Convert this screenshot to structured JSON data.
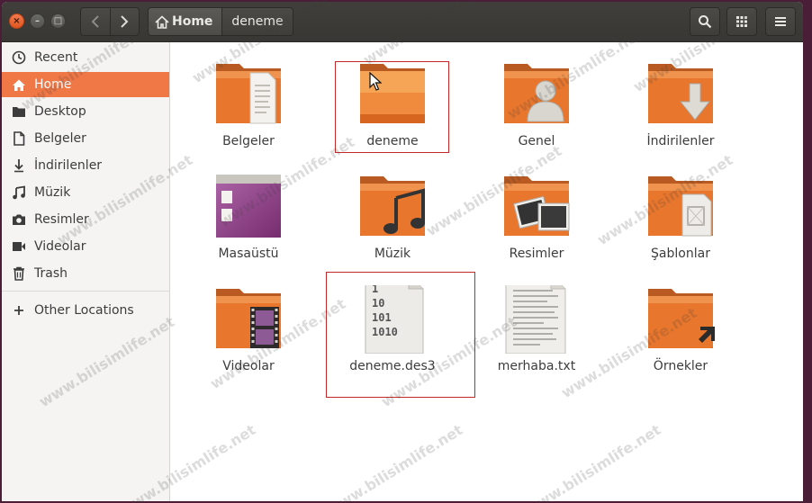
{
  "window": {
    "buttons": {
      "close": "×",
      "minimize": "–",
      "maximize": "□"
    }
  },
  "header": {
    "path": [
      {
        "label": "Home",
        "icon": "home-icon"
      },
      {
        "label": "deneme"
      }
    ],
    "buttons": [
      "search-icon",
      "view-grid-icon",
      "menu-icon"
    ]
  },
  "sidebar": {
    "items": [
      {
        "label": "Recent",
        "icon": "clock-icon"
      },
      {
        "label": "Home",
        "icon": "home-icon",
        "active": true
      },
      {
        "label": "Desktop",
        "icon": "desktop-folder-icon"
      },
      {
        "label": "Belgeler",
        "icon": "document-icon"
      },
      {
        "label": "İndirilenler",
        "icon": "download-icon"
      },
      {
        "label": "Müzik",
        "icon": "music-icon"
      },
      {
        "label": "Resimler",
        "icon": "camera-icon"
      },
      {
        "label": "Videolar",
        "icon": "video-icon"
      },
      {
        "label": "Trash",
        "icon": "trash-icon"
      }
    ],
    "other": {
      "label": "Other Locations",
      "icon": "plus-icon"
    }
  },
  "files": [
    {
      "label": "Belgeler",
      "icon": "documents-folder-icon"
    },
    {
      "label": "deneme",
      "icon": "folder-icon",
      "highlighted": true
    },
    {
      "label": "Genel",
      "icon": "public-folder-icon"
    },
    {
      "label": "İndirilenler",
      "icon": "downloads-folder-icon"
    },
    {
      "label": "Masaüstü",
      "icon": "desktop-folder-icon"
    },
    {
      "label": "Müzik",
      "icon": "music-folder-icon"
    },
    {
      "label": "Resimler",
      "icon": "pictures-folder-icon"
    },
    {
      "label": "Şablonlar",
      "icon": "templates-folder-icon"
    },
    {
      "label": "Videolar",
      "icon": "videos-folder-icon"
    },
    {
      "label": "deneme.des3",
      "icon": "binary-file-icon",
      "highlighted": true
    },
    {
      "label": "merhaba.txt",
      "icon": "text-file-icon"
    },
    {
      "label": "Örnekler",
      "icon": "examples-folder-icon"
    }
  ],
  "binary_file_glyph": [
    "1",
    "10",
    "101",
    "1010"
  ],
  "watermark": "www.bilisimlife.net",
  "colors": {
    "accent": "#f07746",
    "folder": "#e8762d",
    "highlight_box": "#c62828"
  }
}
